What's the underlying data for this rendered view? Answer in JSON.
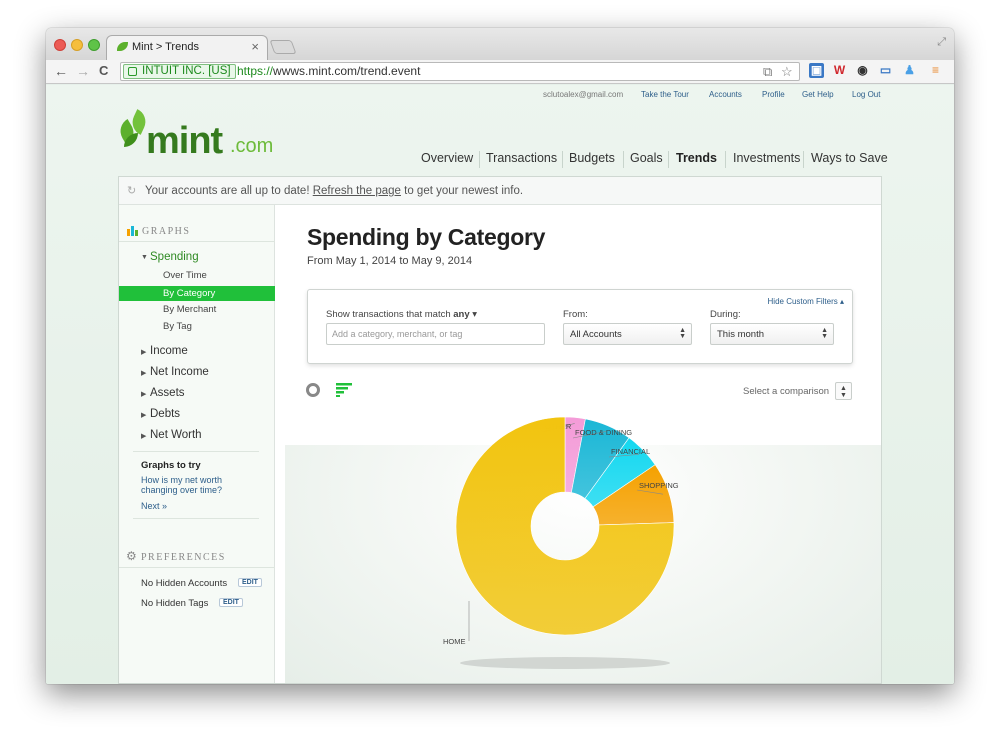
{
  "browser": {
    "tab_title": "Mint > Trends",
    "tab_close": "×",
    "ev_label": "INTUIT INC. [US]",
    "url_scheme": "https://",
    "url_rest": "wwws.mint.com/trend.event",
    "back": "←",
    "forward": "→",
    "reload": "C"
  },
  "topbar": {
    "user_email": "sclutoalex@gmail.com",
    "links": [
      "Take the Tour",
      "Accounts",
      "Profile",
      "Get Help",
      "Log Out"
    ]
  },
  "logo": {
    "brand": "mint",
    "suffix": ".com"
  },
  "nav": {
    "items": [
      "Overview",
      "Transactions",
      "Budgets",
      "Goals",
      "Trends",
      "Investments",
      "Ways to Save"
    ],
    "active": "Trends"
  },
  "status": {
    "prefix": "Your accounts are all up to date! ",
    "link": "Refresh the page",
    "suffix": " to get your newest info."
  },
  "sidebar": {
    "graphs_heading": "GRAPHS",
    "spending": "Spending",
    "spending_sub": [
      "Over Time",
      "By Category",
      "By Merchant",
      "By Tag"
    ],
    "active_sub": "By Category",
    "sections": [
      "Income",
      "Net Income",
      "Assets",
      "Debts",
      "Net Worth"
    ],
    "graphs_to_try_heading": "Graphs to try",
    "graphs_to_try_q1": "How is my net worth",
    "graphs_to_try_q2": "changing over time?",
    "next_link": "Next »",
    "preferences_heading": "PREFERENCES",
    "hidden_accounts": "No Hidden Accounts",
    "hidden_tags": "No Hidden Tags",
    "edit_label": "EDIT"
  },
  "main": {
    "title": "Spending by Category",
    "date_range": "From May 1, 2014 to May 9, 2014",
    "filters": {
      "match_label": "Show transactions that match ",
      "match_value": "any",
      "search_placeholder": "Add a category, merchant, or tag",
      "from_label": "From:",
      "from_value": "All Accounts",
      "during_label": "During:",
      "during_value": "This month",
      "hide_filters": "Hide Custom Filters ▴"
    },
    "compare_label": "Select a comparison"
  },
  "colors": {
    "accent_green": "#20c03a",
    "link_blue": "#2d5e8a",
    "home": "#f2c40f",
    "shopping": "#f5a100",
    "financial": "#14d8f0",
    "food_dining": "#1ab7d6",
    "other": "#f49bd8"
  },
  "chart_data": {
    "type": "pie",
    "donut": true,
    "slices": [
      {
        "label": "OTHER",
        "value": 3,
        "color": "#f49bd8"
      },
      {
        "label": "FOOD & DINING",
        "value": 7,
        "color": "#1ab7d6"
      },
      {
        "label": "FINANCIAL",
        "value": 5.5,
        "color": "#14d8f0"
      },
      {
        "label": "SHOPPING",
        "value": 9,
        "color": "#f5a100"
      },
      {
        "label": "HOME",
        "value": 75.5,
        "color": "#f2c40f"
      }
    ]
  }
}
